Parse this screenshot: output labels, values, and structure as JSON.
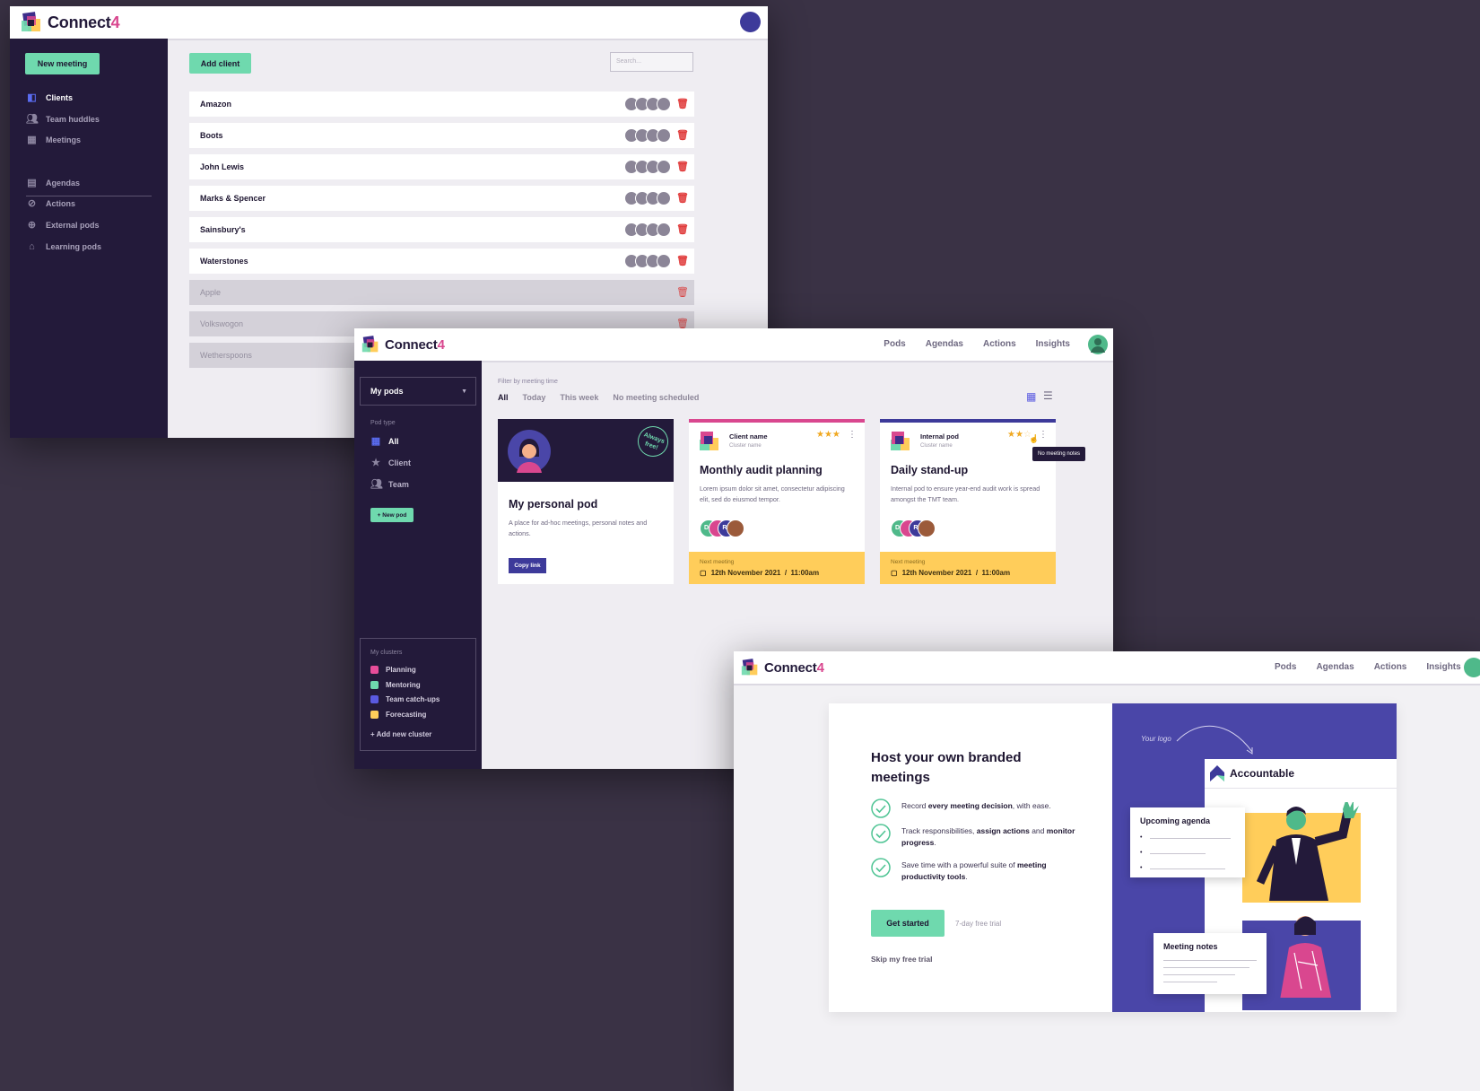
{
  "brand": {
    "name": "Connect",
    "suffix": "4"
  },
  "colors": {
    "accent_green": "#6fd9ae",
    "sidebar": "#231a3a",
    "brand_pink": "#d9478f",
    "indigo": "#4a46a8",
    "amber": "#ffcd5a",
    "danger": "#e03a3a"
  },
  "window1": {
    "new_meeting": "New meeting",
    "add_client": "Add client",
    "search_placeholder": "Search...",
    "sidebar": [
      {
        "label": "Clients",
        "icon": "clients-icon"
      },
      {
        "label": "Team huddles",
        "icon": "people-icon"
      },
      {
        "label": "Meetings",
        "icon": "calendar-icon"
      },
      {
        "label": "Agendas",
        "icon": "agenda-icon"
      },
      {
        "label": "Actions",
        "icon": "check-circle-icon"
      },
      {
        "label": "External pods",
        "icon": "globe-icon"
      },
      {
        "label": "Learning pods",
        "icon": "institution-icon"
      }
    ],
    "clients": [
      "Amazon",
      "Boots",
      "John Lewis",
      "Marks & Spencer",
      "Sainsbury's",
      "Waterstones"
    ],
    "archived_clients": [
      "Apple",
      "Volkswogon",
      "Wetherspoons"
    ]
  },
  "window2": {
    "nav": [
      "Pods",
      "Agendas",
      "Actions",
      "Insights"
    ],
    "my_pods": "My pods",
    "pod_type_label": "Pod type",
    "pod_types": [
      "All",
      "Client",
      "Team"
    ],
    "new_pod": "+ New pod",
    "my_clusters_label": "My clusters",
    "clusters": [
      {
        "label": "Planning",
        "color": "#e84d9a"
      },
      {
        "label": "Mentoring",
        "color": "#6fd9ae"
      },
      {
        "label": "Team catch-ups",
        "color": "#5a5ae0"
      },
      {
        "label": "Forecasting",
        "color": "#ffcd5a"
      }
    ],
    "add_cluster": "+ Add new cluster",
    "filter_label": "Filter by meeting time",
    "filters": [
      "All",
      "Today",
      "This week",
      "No meeting scheduled"
    ],
    "personal_pod": {
      "badge": "Always free!",
      "title": "My personal pod",
      "description": "A place for ad-hoc meetings, personal notes and actions.",
      "button": "Copy link"
    },
    "cards": [
      {
        "kicker": "Client name",
        "sub": "Cluster name",
        "stars": 3,
        "title": "Monthly audit planning",
        "description": "Lorem ipsum dolor sit amet, consectetur adipiscing elit, sed do eiusmod tempor.",
        "people": [
          "DC",
          "",
          "RT",
          ""
        ],
        "next_label": "Next meeting",
        "next_date": "12th November 2021  /  11:00am",
        "color": "#d9478f"
      },
      {
        "kicker": "Internal pod",
        "sub": "Cluster name",
        "stars": 2,
        "title": "Daily stand-up",
        "description": "Internal pod to ensure year-end audit work is spread amongst the TMT team.",
        "people": [
          "DC",
          "",
          "RT",
          ""
        ],
        "next_label": "Next meeting",
        "next_date": "12th November 2021  /  11:00am",
        "color": "#3d3a9a"
      }
    ],
    "tooltip": "No meeting notes"
  },
  "window3": {
    "nav": [
      "Pods",
      "Agendas",
      "Actions",
      "Insights"
    ],
    "headline": "Host your own branded meetings",
    "features": [
      {
        "pre": "Record ",
        "bold": "every meeting decision",
        "post": ", with ease.",
        "bold2": "",
        "post2": ""
      },
      {
        "pre": "Track responsibilities, ",
        "bold": "assign actions",
        "post": " and ",
        "bold2": "monitor progress",
        "post2": "."
      },
      {
        "pre": "Save time with a powerful suite of ",
        "bold": "meeting productivity tools",
        "post": ".",
        "bold2": "",
        "post2": ""
      }
    ],
    "cta": "Get started",
    "trial": "7-day free trial",
    "skip": "Skip my free trial",
    "your_logo": "Your logo",
    "accountable": "Accountable",
    "upcoming_agenda": "Upcoming agenda",
    "meeting_notes": "Meeting notes"
  }
}
